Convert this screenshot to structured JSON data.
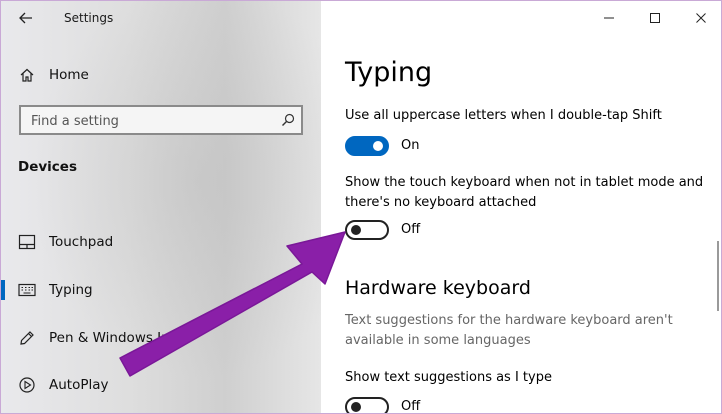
{
  "window": {
    "title": "Settings"
  },
  "sidebar": {
    "home_label": "Home",
    "search_placeholder": "Find a setting",
    "section_title": "Devices",
    "items": [
      {
        "label": "Touchpad",
        "icon": "touchpad-icon"
      },
      {
        "label": "Typing",
        "icon": "keyboard-icon",
        "selected": true
      },
      {
        "label": "Pen & Windows Ink",
        "icon": "pen-icon"
      },
      {
        "label": "AutoPlay",
        "icon": "autoplay-icon"
      }
    ]
  },
  "main": {
    "title": "Typing",
    "settings": [
      {
        "label": "Use all uppercase letters when I double-tap Shift",
        "state": "On"
      },
      {
        "label": "Show the touch keyboard when not in tablet mode and there's no keyboard attached",
        "state": "Off"
      }
    ],
    "hardware": {
      "heading": "Hardware keyboard",
      "description": "Text suggestions for the hardware keyboard aren't available in some languages",
      "setting_label": "Show text suggestions as I type",
      "state": "Off"
    }
  },
  "colors": {
    "accent": "#0067c0",
    "annotation_arrow": "#8a1fa8"
  }
}
